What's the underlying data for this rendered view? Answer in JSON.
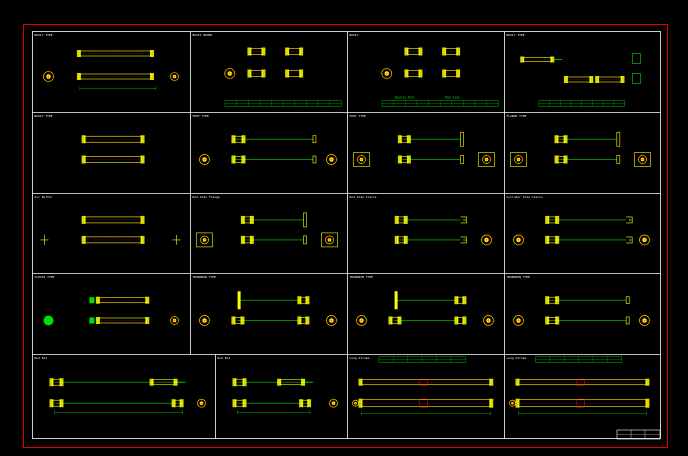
{
  "drawing": {
    "title_block": "",
    "colors": {
      "frame": "#e00000",
      "grid": "#ffffff",
      "part": "#ffff00",
      "dim": "#00e000",
      "accent": "#ff0000",
      "background": "#000000"
    },
    "rows": [
      [
        {
          "title": "BASIC TYPE",
          "kind": "basic"
        },
        {
          "title": "BASIC MOUNT",
          "kind": "mount-table"
        },
        {
          "title": "BASIC",
          "sub_a": "Double Rod",
          "sub_b": "Rod Side",
          "kind": "mount-table"
        },
        {
          "title": "BASIC TYPE",
          "kind": "pins"
        }
      ],
      [
        {
          "title": "BASIC TYPE",
          "kind": "double"
        },
        {
          "title": "FOOT TYPE",
          "kind": "long"
        },
        {
          "title": "FOOT TYPE",
          "kind": "foot"
        },
        {
          "title": "FLANGE TYPE",
          "kind": "flange"
        }
      ],
      [
        {
          "title": "Air Buffer",
          "kind": "double-end"
        },
        {
          "title": "Rod Side Flange",
          "kind": "rod-flange"
        },
        {
          "title": "Rod Side Clevis",
          "kind": "clevis"
        },
        {
          "title": "Cylinder Side Clevis",
          "kind": "clevis2"
        }
      ],
      [
        {
          "title": "CLEVIS TYPE",
          "kind": "clevis-green"
        },
        {
          "title": "TRUNNION TYPE",
          "kind": "trunnion"
        },
        {
          "title": "TRUNNION TYPE",
          "kind": "trunnion2"
        },
        {
          "title": "TRUNNION TYPE",
          "kind": "trunnion3"
        }
      ],
      [
        {
          "title": "Rod End",
          "kind": "rod-end"
        },
        {
          "title": "Rod End",
          "kind": "rod-end2"
        },
        {
          "title": "Long Stroke",
          "kind": "long-stroke"
        },
        {
          "title": "Long Stroke",
          "kind": "long-stroke2"
        }
      ]
    ]
  }
}
